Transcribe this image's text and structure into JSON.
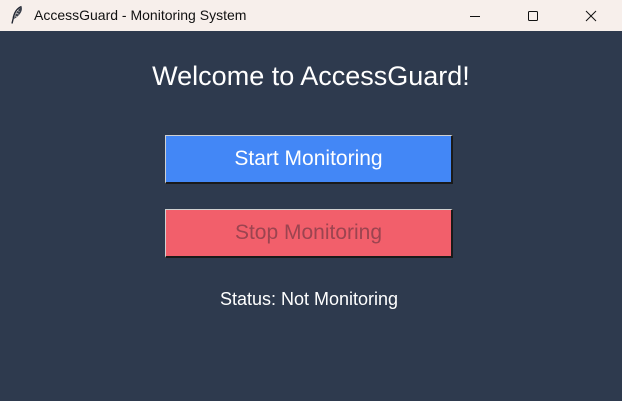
{
  "window": {
    "title": "AccessGuard - Monitoring System",
    "app_icon": "feather-icon",
    "controls": {
      "minimize_icon": "minimize-icon",
      "maximize_icon": "maximize-icon",
      "close_icon": "close-icon"
    }
  },
  "main": {
    "heading": "Welcome to AccessGuard!",
    "start_button_label": "Start Monitoring",
    "stop_button_label": "Stop Monitoring",
    "status_text": "Status: Not Monitoring"
  },
  "colors": {
    "background": "#2e3a4e",
    "titlebar": "#f7efeb",
    "start_button": "#4387f6",
    "stop_button": "#f25f6b",
    "stop_button_text": "#9c4450"
  }
}
